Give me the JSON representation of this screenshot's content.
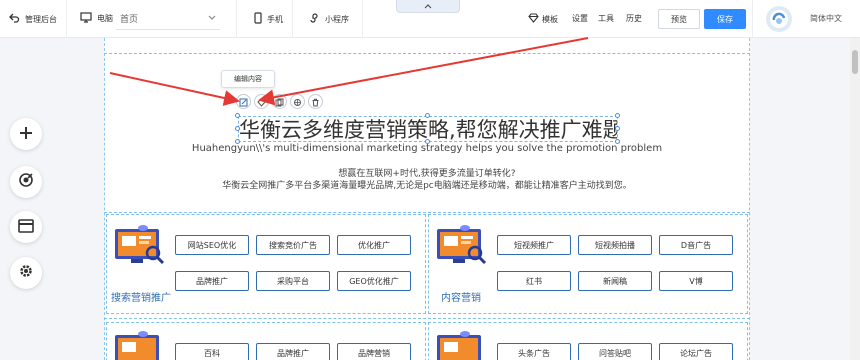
{
  "topbar": {
    "back_label": "管理后台",
    "device_label": "电脑",
    "page_select_value": "首页",
    "mobile_label": "手机",
    "miniapp_label": "小程序",
    "template_label": "模板",
    "settings_label": "设置",
    "tools_label": "工具",
    "history_label": "历史",
    "preview_label": "预览",
    "save_label": "保存",
    "language_value": "简体中文"
  },
  "editor": {
    "tooltip": "编辑内容",
    "headline": "华衡云多维度营销策略,帮您解决推广难题",
    "subtitle_en": "Huahengyun\\\\'s multi-dimensional marketing strategy helps you solve the promotion problem",
    "line1": "想赢在互联网+时代,获得更多流量订单转化?",
    "line2": "华衡云全网推广多平台多渠道海量曝光品牌,无论是pc电脑端还是移动端，都能让精准客户主动找到您。"
  },
  "cards": [
    {
      "label": "搜索营销推广",
      "tags": [
        "网站SEO优化",
        "搜索竞价广告",
        "优化推广",
        "品牌推广",
        "采购平台",
        "GEO优化推广"
      ]
    },
    {
      "label": "内容营销",
      "tags": [
        "短视频推广",
        "短视频拍播",
        "D音广告",
        "红书",
        "新闻稿",
        "V博"
      ]
    },
    {
      "label": "",
      "tags": [
        "百科",
        "品牌推广",
        "品牌营销"
      ]
    },
    {
      "label": "",
      "tags": [
        "头条广告",
        "问答贴吧",
        "论坛广告"
      ]
    }
  ],
  "colors": {
    "accent": "#2f8bff",
    "tag_border": "#2f6db3",
    "annotation_arrow": "#e53935"
  }
}
